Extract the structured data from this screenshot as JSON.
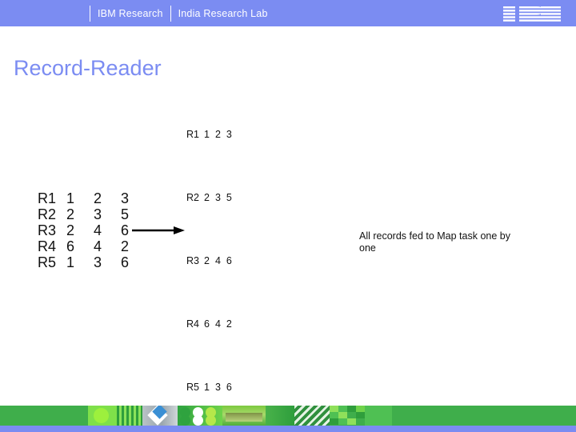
{
  "header": {
    "brand": "IBM Research",
    "lab": "India Research Lab",
    "logo_alt": "IBM"
  },
  "title": "Record-Reader",
  "colors": {
    "brand_periwinkle": "#7b8cf2",
    "title": "#7b8cf2",
    "footer_green": "#3fae4b",
    "text": "#111111"
  },
  "matrix": {
    "rows": [
      {
        "id": "R1",
        "values": [
          "1",
          "2",
          "3"
        ]
      },
      {
        "id": "R2",
        "values": [
          "2",
          "3",
          "5"
        ]
      },
      {
        "id": "R3",
        "values": [
          "2",
          "4",
          "6"
        ]
      },
      {
        "id": "R4",
        "values": [
          "6",
          "4",
          "2"
        ]
      },
      {
        "id": "R5",
        "values": [
          "1",
          "3",
          "6"
        ]
      }
    ]
  },
  "arrow": {
    "direction": "right",
    "label": ""
  },
  "records": [
    {
      "id": "R1",
      "values": [
        "1",
        "2",
        "3"
      ]
    },
    {
      "id": "R2",
      "values": [
        "2",
        "3",
        "5"
      ]
    },
    {
      "id": "R3",
      "values": [
        "2",
        "4",
        "6"
      ]
    },
    {
      "id": "R4",
      "values": [
        "6",
        "4",
        "2"
      ]
    },
    {
      "id": "R5",
      "values": [
        "1",
        "3",
        "6"
      ]
    }
  ],
  "caption": "All records fed to Map task one by one"
}
